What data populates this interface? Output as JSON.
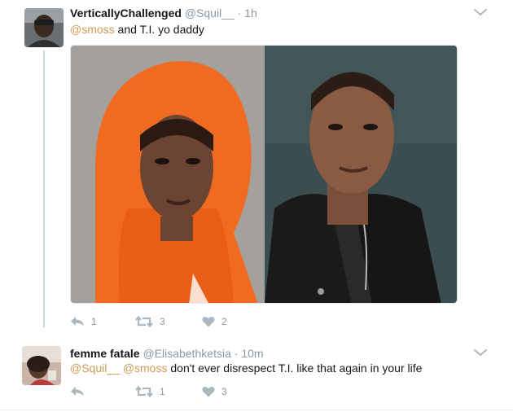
{
  "tweets": [
    {
      "name": "VerticallyChallenged",
      "handle": "@Squil__",
      "time": "· 1h",
      "mention1": "@smoss",
      "text_rest": " and T.I. yo daddy",
      "reply_count": "1",
      "retweet_count": "3",
      "like_count": "2",
      "media_description_left": "photo-orange-hoodie",
      "media_description_right": "photo-leather-jacket"
    },
    {
      "name": "femme fatale",
      "handle": "@Elisabethketsia",
      "time": "· 10m",
      "mention1": "@Squil__",
      "mention2": "@smoss",
      "text_rest": " don't ever disrespect T.I. like that again in your life",
      "reply_count": "",
      "retweet_count": "1",
      "like_count": "3"
    }
  ],
  "colors": {
    "mention": "#cc9a55",
    "muted": "#8899a6",
    "thread_line": "#ccd6dd",
    "name": "#14171a"
  },
  "icons": [
    "reply-icon",
    "retweet-icon",
    "heart-icon",
    "chevron-down-icon"
  ]
}
